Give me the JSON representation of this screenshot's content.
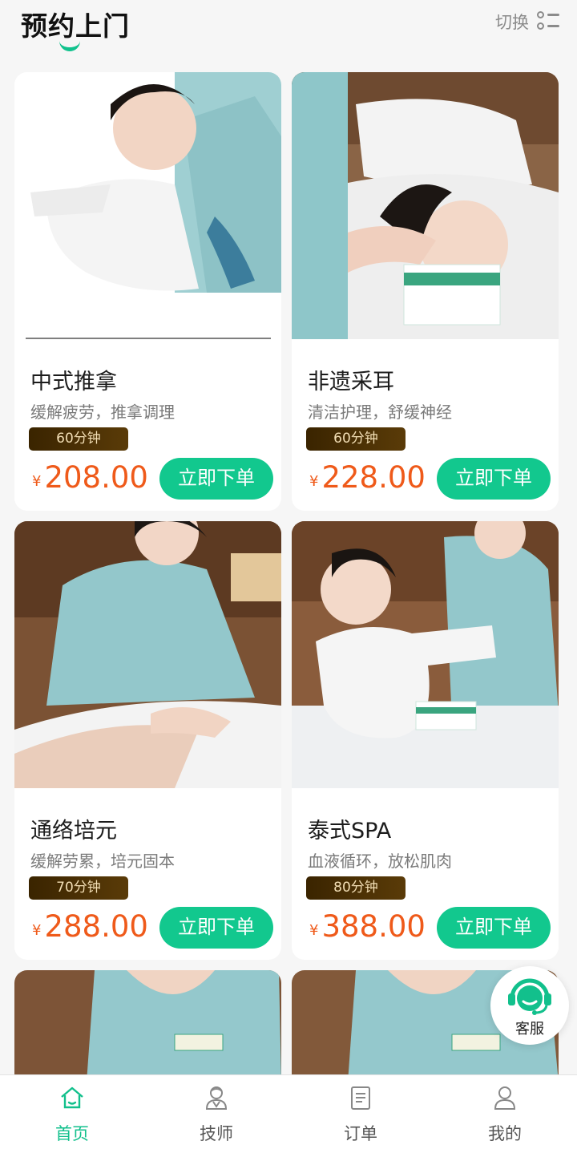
{
  "header": {
    "title": "预约上门",
    "switch_label": "切换"
  },
  "services": [
    {
      "name": "中式推拿",
      "desc": "缓解疲劳，推拿调理",
      "duration": "60分钟",
      "currency": "¥",
      "price": "208.00",
      "button": "立即下单"
    },
    {
      "name": "非遗采耳",
      "desc": "清洁护理，舒缓神经",
      "duration": "60分钟",
      "currency": "¥",
      "price": "228.00",
      "button": "立即下单"
    },
    {
      "name": "通络培元",
      "desc": "缓解劳累，培元固本",
      "duration": "70分钟",
      "currency": "¥",
      "price": "288.00",
      "button": "立即下单"
    },
    {
      "name": "泰式SPA",
      "desc": "血液循环，放松肌肉",
      "duration": "80分钟",
      "currency": "¥",
      "price": "388.00",
      "button": "立即下单"
    }
  ],
  "service_float": {
    "label": "客服",
    "icon": "headset-icon"
  },
  "tabbar": [
    {
      "label": "首页",
      "icon": "home-icon",
      "active": true
    },
    {
      "label": "技师",
      "icon": "technician-icon",
      "active": false
    },
    {
      "label": "订单",
      "icon": "order-icon",
      "active": false
    },
    {
      "label": "我的",
      "icon": "profile-icon",
      "active": false
    }
  ],
  "colors": {
    "accent": "#12c88e",
    "price": "#ef5a1a",
    "duration_bg": "#3a2400",
    "duration_text": "#f3dfb6"
  }
}
